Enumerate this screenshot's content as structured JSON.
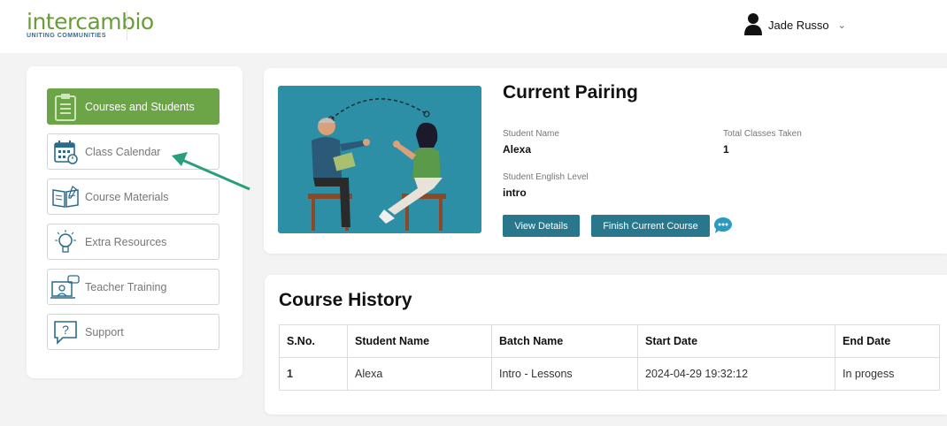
{
  "header": {
    "logo_text": "intercambio",
    "logo_tagline": "UNITING COMMUNITIES",
    "user_name": "Jade Russo"
  },
  "sidebar": {
    "items": [
      {
        "label": "Courses and Students",
        "icon": "clipboard-icon"
      },
      {
        "label": "Class Calendar",
        "icon": "calendar-icon"
      },
      {
        "label": "Course Materials",
        "icon": "book-icon"
      },
      {
        "label": "Extra Resources",
        "icon": "lightbulb-icon"
      },
      {
        "label": "Teacher Training",
        "icon": "presentation-icon"
      },
      {
        "label": "Support",
        "icon": "question-icon"
      }
    ]
  },
  "pairing": {
    "title": "Current Pairing",
    "student_name_label": "Student Name",
    "student_name": "Alexa",
    "total_classes_label": "Total Classes Taken",
    "total_classes": "1",
    "level_label": "Student English Level",
    "level": "intro",
    "view_details_label": "View Details",
    "finish_course_label": "Finish Current Course"
  },
  "history": {
    "title": "Course History",
    "columns": [
      "S.No.",
      "Student Name",
      "Batch Name",
      "Start Date",
      "End Date"
    ],
    "rows": [
      [
        "1",
        "Alexa",
        "Intro - Lessons",
        "2024-04-29 19:32:12",
        "In progess"
      ]
    ]
  },
  "colors": {
    "accent_green": "#6ba548",
    "button_teal": "#28778d",
    "annotation_arrow": "#2a9d7c"
  }
}
